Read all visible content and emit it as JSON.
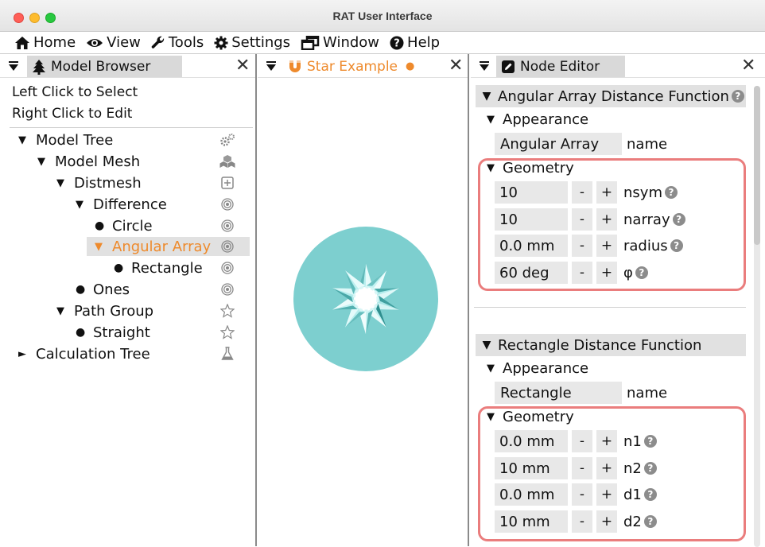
{
  "window": {
    "title": "RAT User Interface"
  },
  "menu": [
    {
      "label": "Home",
      "icon": "home-icon"
    },
    {
      "label": "View",
      "icon": "eye-icon"
    },
    {
      "label": "Tools",
      "icon": "wrench-icon"
    },
    {
      "label": "Settings",
      "icon": "gear-icon"
    },
    {
      "label": "Window",
      "icon": "window-icon"
    },
    {
      "label": "Help",
      "icon": "question-circle-icon"
    }
  ],
  "model_browser": {
    "tab_label": "Model Browser",
    "hint_select": "Left Click to Select",
    "hint_edit": "Right Click to Edit",
    "tree": [
      {
        "label": "Model Tree",
        "marker": "▼",
        "icon": "gears-icon"
      },
      {
        "label": "Model Mesh",
        "marker": "▼",
        "icon": "cubes-icon"
      },
      {
        "label": "Distmesh",
        "marker": "▼",
        "icon": "plus-square-icon"
      },
      {
        "label": "Difference",
        "marker": "▼",
        "icon": "target-icon"
      },
      {
        "label": "Circle",
        "marker": "●",
        "icon": "target-icon"
      },
      {
        "label": "Angular Array",
        "marker": "▼",
        "icon": "target-icon",
        "selected": true
      },
      {
        "label": "Rectangle",
        "marker": "●",
        "icon": "target-icon"
      },
      {
        "label": "Ones",
        "marker": "●",
        "icon": "target-icon"
      },
      {
        "label": "Path Group",
        "marker": "▼",
        "icon": "star-outline-icon"
      },
      {
        "label": "Straight",
        "marker": "●",
        "icon": "star-outline-icon"
      },
      {
        "label": "Calculation Tree",
        "marker": "►",
        "icon": "flask-icon"
      }
    ]
  },
  "viewport": {
    "tab_label": "Star Example",
    "tab_status_dot": "●",
    "accent": "#ee8a2c",
    "circle_color": "#7dcfcf"
  },
  "node_editor": {
    "tab_label": "Node Editor",
    "angular": {
      "header": "Angular Array Distance Function",
      "appearance": "Appearance",
      "name_value": "Angular Array",
      "name_label": "name",
      "geometry": "Geometry",
      "params": [
        {
          "value": "10",
          "label": "nsym"
        },
        {
          "value": "10",
          "label": "narray"
        },
        {
          "value": "0.0 mm",
          "label": "radius"
        },
        {
          "value": "60 deg",
          "label": "φ"
        }
      ]
    },
    "rectangle": {
      "header": "Rectangle Distance Function",
      "appearance": "Appearance",
      "name_value": "Rectangle",
      "name_label": "name",
      "geometry": "Geometry",
      "params": [
        {
          "value": "0.0 mm",
          "label": "n1"
        },
        {
          "value": "10 mm",
          "label": "n2"
        },
        {
          "value": "0.0 mm",
          "label": "d1"
        },
        {
          "value": "10 mm",
          "label": "d2"
        }
      ]
    },
    "minus": "-",
    "plus": "+",
    "help_glyph": "?"
  },
  "close_glyph": "✕",
  "highlight_color": "#ea7d7d"
}
